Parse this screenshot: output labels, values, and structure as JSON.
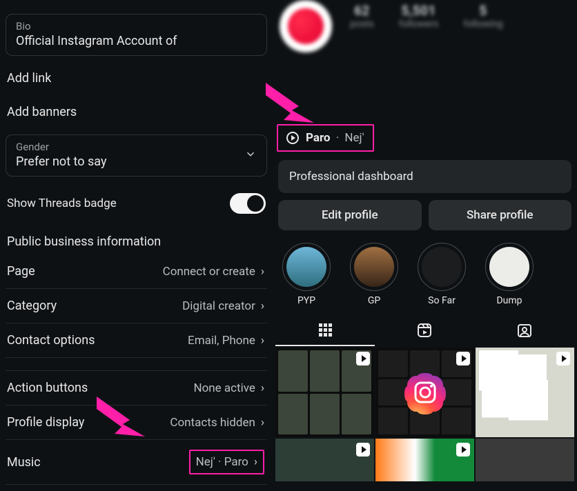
{
  "edit": {
    "bio": {
      "label": "Bio",
      "value": "Official Instagram Account of"
    },
    "add_link": "Add link",
    "add_banners": "Add banners",
    "gender": {
      "label": "Gender",
      "value": "Prefer not to say"
    },
    "threads": {
      "label": "Show Threads badge",
      "on": true
    },
    "section": "Public business information",
    "settings": [
      {
        "label": "Page",
        "value": "Connect or create"
      },
      {
        "label": "Category",
        "value": "Digital creator"
      },
      {
        "label": "Contact options",
        "value": "Email, Phone"
      },
      {
        "label": "Action buttons",
        "value": "None active"
      },
      {
        "label": "Profile display",
        "value": "Contacts hidden"
      },
      {
        "label": "Music",
        "value": "Nej' · Paro"
      }
    ]
  },
  "profile": {
    "stats": {
      "posts": "62",
      "followers": "5,501",
      "following": "5",
      "posts_label": "posts",
      "followers_label": "followers",
      "following_label": "following"
    },
    "music": {
      "title": "Paro",
      "sep": " · ",
      "artist": "Nej'"
    },
    "dashboard": "Professional dashboard",
    "buttons": {
      "edit": "Edit profile",
      "share": "Share profile"
    },
    "highlights": [
      {
        "name": "PYP"
      },
      {
        "name": "GP"
      },
      {
        "name": "So Far"
      },
      {
        "name": "Dump"
      }
    ]
  }
}
